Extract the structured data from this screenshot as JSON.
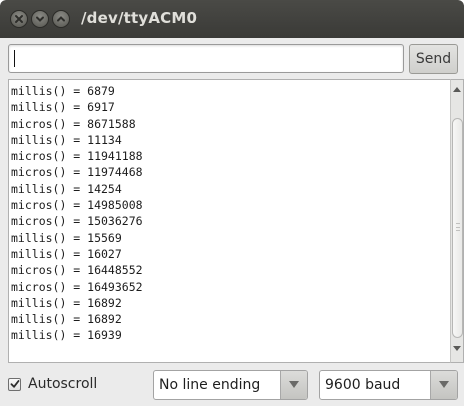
{
  "window": {
    "title": "/dev/ttyACM0"
  },
  "input": {
    "value": "",
    "placeholder": ""
  },
  "send_button": {
    "label": "Send"
  },
  "console": {
    "lines": [
      "millis() = 6879",
      "millis() = 6917",
      "micros() = 8671588",
      "millis() = 11134",
      "micros() = 11941188",
      "micros() = 11974468",
      "millis() = 14254",
      "micros() = 14985008",
      "micros() = 15036276",
      "millis() = 15569",
      "millis() = 16027",
      "micros() = 16448552",
      "micros() = 16493652",
      "millis() = 16892",
      "millis() = 16892",
      "millis() = 16939"
    ]
  },
  "bottom": {
    "autoscroll_label": "Autoscroll",
    "autoscroll_checked": true,
    "line_ending": "No line ending",
    "baud": "9600 baud"
  },
  "icons": {
    "close": "close-icon",
    "minimize": "minimize-icon",
    "maximize": "maximize-icon",
    "scroll_up": "arrow-up-icon",
    "scroll_down": "arrow-down-icon",
    "dropdown": "chevron-down-icon",
    "checkmark": "checkmark-icon"
  },
  "colors": {
    "titlebar": "#3f3f3c",
    "window_bg": "#ebebeb",
    "console_bg": "#ffffff"
  }
}
